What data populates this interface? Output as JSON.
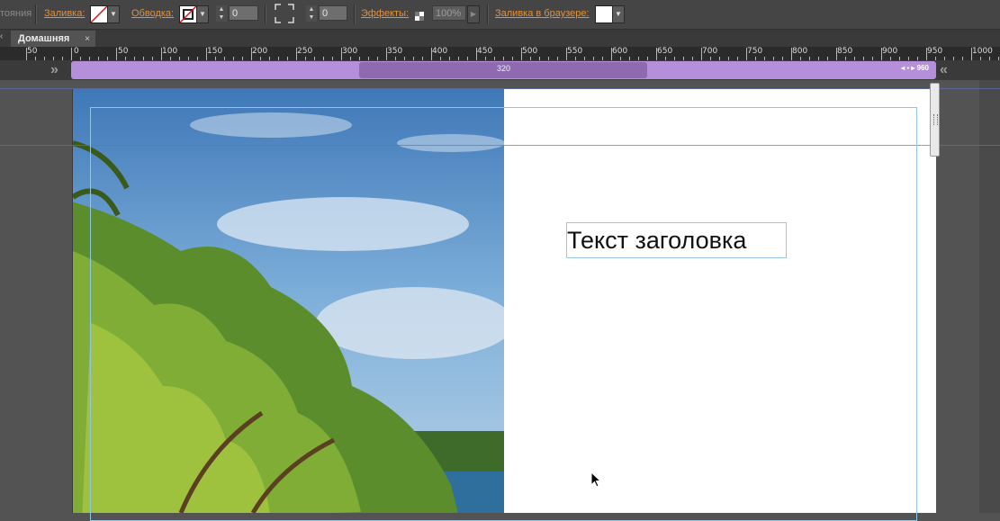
{
  "toolbar": {
    "states_label": "тояния",
    "fill_label": "Заливка:",
    "stroke_label": "Обводка:",
    "stroke_width_value": "0",
    "corner_radius_value": "0",
    "effects_label": "Эффекты:",
    "opacity_value": "100%",
    "browser_fill_label": "Заливка в браузере:"
  },
  "tabs": [
    {
      "label": "Домашняя",
      "close": "×"
    }
  ],
  "ruler": {
    "labels": [
      "0",
      "50",
      "100",
      "150",
      "200",
      "250",
      "300",
      "350",
      "400",
      "450",
      "500",
      "550",
      "600",
      "650",
      "700",
      "750",
      "800",
      "850",
      "900",
      "950",
      "1000"
    ],
    "left_partial": "50"
  },
  "breakpoints": {
    "center_label": "320",
    "right_label": "960"
  },
  "canvas": {
    "heading_text": "Текст заголовка"
  },
  "colors": {
    "accent_orange": "#e3913b",
    "breakpoint_purple": "#b58fd9",
    "breakpoint_dark": "#8f6ab0",
    "guide_blue": "#8fc5e6"
  }
}
